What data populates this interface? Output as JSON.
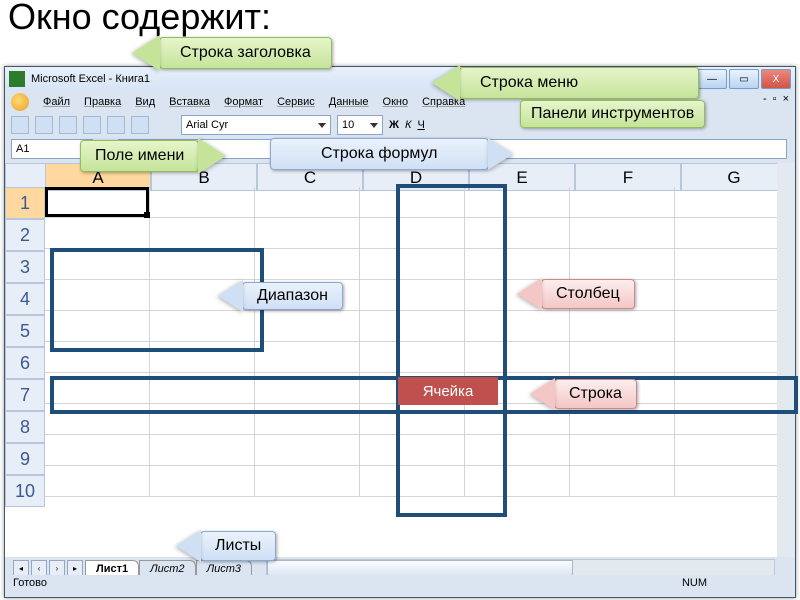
{
  "page": {
    "heading": "Окно содержит:"
  },
  "callouts": {
    "title_bar": "Строка заголовка",
    "menu_bar": "Строка меню",
    "name_box": "Поле имени",
    "formula_bar": "Строка формул",
    "toolbars": "Панели инструментов",
    "range": "Диапазон",
    "column": "Столбец",
    "row": "Строка",
    "cell": "Ячейка",
    "sheets": "Листы"
  },
  "window": {
    "title": "Microsoft Excel - Книга1",
    "menu": [
      "Файл",
      "Правка",
      "Вид",
      "Вставка",
      "Формат",
      "Сервис",
      "Данные",
      "Окно",
      "Справка"
    ],
    "font": "Arial Cyr",
    "font_size": "10",
    "bold": "Ж",
    "italic": "К",
    "underline": "Ч",
    "name_box_value": "A1",
    "columns": [
      "A",
      "B",
      "C",
      "D",
      "E",
      "F",
      "G"
    ],
    "rows": [
      "1",
      "2",
      "3",
      "4",
      "5",
      "6",
      "7",
      "8",
      "9",
      "10"
    ],
    "tabs": [
      "Лист1",
      "Лист2",
      "Лист3"
    ],
    "status": "Готово",
    "status_right": "NUM"
  }
}
